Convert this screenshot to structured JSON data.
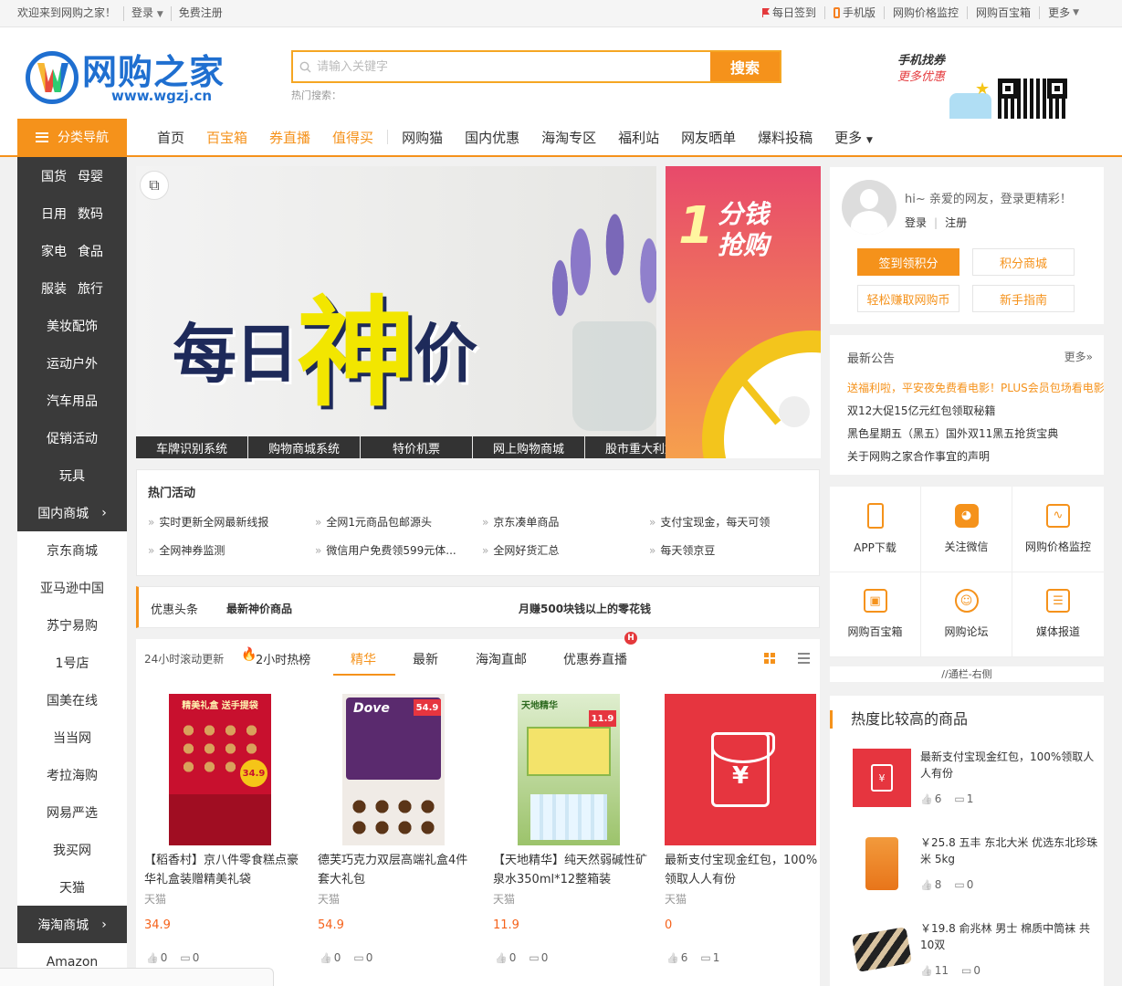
{
  "topbar": {
    "welcome": "欢迎来到网购之家！",
    "login": "登录",
    "register": "免费注册",
    "checkin": "每日签到",
    "mobile": "手机版",
    "price_monitor": "网购价格监控",
    "baibaoxiang": "网购百宝箱",
    "more": "更多"
  },
  "logo": {
    "name": "网购之家",
    "url": "www.wgzj.cn"
  },
  "search": {
    "placeholder": "请输入关键字",
    "button": "搜索",
    "hot_label": "热门搜索："
  },
  "promo": {
    "line1": "手机找券",
    "line2": "更多优惠"
  },
  "nav": {
    "category_button": "分类导航",
    "items": [
      "首页",
      "百宝箱",
      "券直播",
      "值得买",
      "网购猫",
      "国内优惠",
      "海淘专区",
      "福利站",
      "网友晒单",
      "爆料投稿",
      "更多"
    ]
  },
  "sidebar": {
    "category_pairs": [
      [
        "国货",
        "母婴"
      ],
      [
        "日用",
        "数码"
      ],
      [
        "家电",
        "食品"
      ],
      [
        "服装",
        "旅行"
      ]
    ],
    "category_single": [
      "美妆配饰",
      "运动户外",
      "汽车用品",
      "促销活动",
      "玩具"
    ],
    "domestic_head": "国内商城",
    "domestic": [
      "京东商城",
      "亚马逊中国",
      "苏宁易购",
      "1号店",
      "国美在线",
      "当当网",
      "考拉海购",
      "网易严选",
      "我买网",
      "天猫"
    ],
    "overseas_head": "海淘商城",
    "overseas": [
      "Amazon"
    ]
  },
  "banner": {
    "slogan_a": "每日",
    "slogan_big": "神",
    "slogan_b": "价",
    "tabs": [
      "车牌识别系统",
      "购物商城系统",
      "特价机票",
      "网上购物商城",
      "股市重大利好"
    ],
    "side_one": "1",
    "side_line1": "分钱",
    "side_line2": "抢购"
  },
  "user": {
    "greeting": "hi~ 亲爱的网友，登录更精彩！",
    "login": "登录",
    "register": "注册",
    "btn_checkin": "签到领积分",
    "btn_mall": "积分商城",
    "btn_earn": "轻松赚取网购币",
    "btn_guide": "新手指南"
  },
  "notice": {
    "title": "最新公告",
    "more": "更多»",
    "items": [
      "送福利啦，平安夜免费看电影！PLUS会员包场看电影",
      "双12大促15亿元红包领取秘籍",
      "黑色星期五（黑五）国外双11黑五抢货宝典",
      "关于网购之家合作事宜的声明"
    ]
  },
  "apps": [
    {
      "label": "APP下载",
      "icon": "phone-icon"
    },
    {
      "label": "关注微信",
      "icon": "wechat-icon"
    },
    {
      "label": "网购价格监控",
      "icon": "chart-icon"
    },
    {
      "label": "网购百宝箱",
      "icon": "box-icon"
    },
    {
      "label": "网购论坛",
      "icon": "users-icon"
    },
    {
      "label": "媒体报道",
      "icon": "list-icon"
    }
  ],
  "tonglan": "//通栏-右侧",
  "hotgoods": {
    "title": "热度比较高的商品",
    "items": [
      {
        "title": "最新支付宝现金红包，100%领取人人有份",
        "likes": "6",
        "comments": "1"
      },
      {
        "title": "￥25.8 五丰 东北大米 优选东北珍珠米 5kg",
        "likes": "8",
        "comments": "0"
      },
      {
        "title": "￥19.8 俞兆林 男士 棉质中筒袜 共10双",
        "likes": "11",
        "comments": "0"
      }
    ]
  },
  "hotact": {
    "title": "热门活动",
    "items": [
      "实时更新全网最新线报",
      "全网1元商品包邮源头",
      "京东凑单商品",
      "支付宝现金，每天可领",
      "全网神券监测",
      "微信用户免费领599元体...",
      "全网好货汇总",
      "每天领京豆"
    ]
  },
  "headline": {
    "label": "优惠头条",
    "a": "最新神价商品",
    "b": "月赚500块钱以上的零花钱"
  },
  "feed": {
    "rolling": "24小时滚动更新",
    "hot24": "2小时热榜",
    "tabs": [
      "精华",
      "最新",
      "海淘直邮",
      "优惠券直播"
    ],
    "badge": "H"
  },
  "products": [
    {
      "title": "【稻香村】京八件零食糕点豪华礼盒装赠精美礼袋",
      "shop": "天猫",
      "price": "34.9",
      "likes": "0",
      "comments": "0",
      "img_text": "精美礼盒 送手提袋",
      "img_price": "34.9"
    },
    {
      "title": "德芙巧克力双层高端礼盒4件套大礼包",
      "shop": "天猫",
      "price": "54.9",
      "likes": "0",
      "comments": "0",
      "img_text": "Dove",
      "img_price": "54.9"
    },
    {
      "title": "【天地精华】纯天然弱碱性矿泉水350ml*12整箱装",
      "shop": "天猫",
      "price": "11.9",
      "likes": "0",
      "comments": "0",
      "img_text": "天地精华",
      "img_price": "11.9"
    },
    {
      "title": "最新支付宝现金红包，100%领取人人有份",
      "shop": "天猫",
      "price": "0",
      "likes": "6",
      "comments": "1",
      "img_text": "¥",
      "img_price": ""
    }
  ],
  "colors": {
    "accent": "#f5921b",
    "dark": "#3a3a3a",
    "red": "#e6353f"
  }
}
